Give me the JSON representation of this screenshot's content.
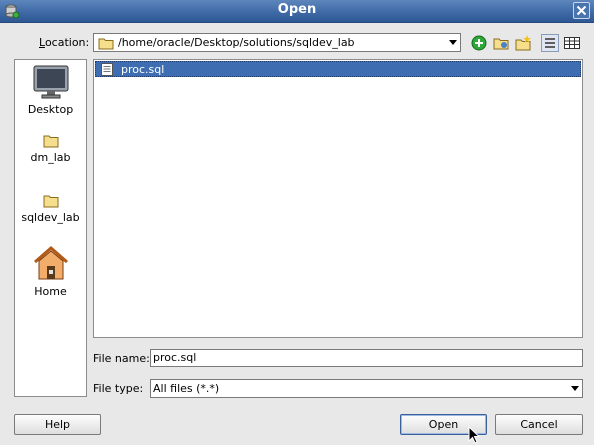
{
  "window": {
    "title": "Open"
  },
  "toolbar": {
    "location_label": "Location:",
    "location_value": "/home/oracle/Desktop/solutions/sqldev_lab"
  },
  "sidebar": {
    "items": [
      {
        "label": "Desktop",
        "icon": "desktop-icon"
      },
      {
        "label": "dm_lab",
        "icon": "folder-icon"
      },
      {
        "label": "sqldev_lab",
        "icon": "folder-icon"
      },
      {
        "label": "Home",
        "icon": "home-icon"
      }
    ]
  },
  "files": [
    {
      "name": "proc.sql",
      "icon": "sql-file-icon",
      "selected": true
    }
  ],
  "form": {
    "file_name_label": "File name:",
    "file_name_value": "proc.sql",
    "file_type_label": "File type:",
    "file_type_value": "All files (*.*)"
  },
  "buttons": {
    "help": "Help",
    "open": "Open",
    "cancel": "Cancel"
  },
  "colors": {
    "titlebar": "#3f6aa6",
    "selection": "#3e6db1",
    "background": "#e8e8e8"
  }
}
